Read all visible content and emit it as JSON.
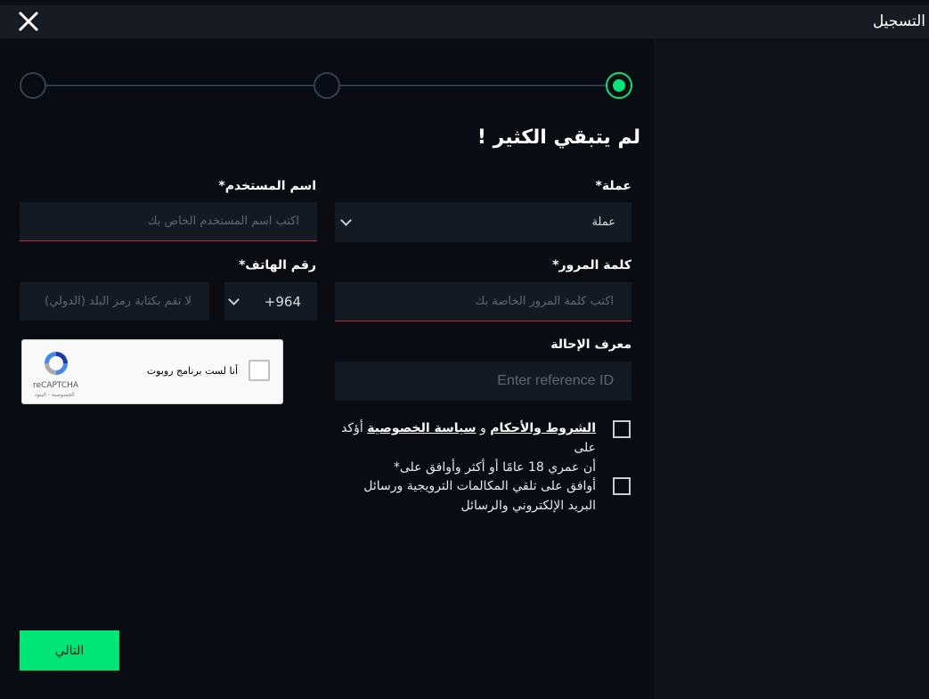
{
  "header": {
    "title": "التسجيل"
  },
  "form": {
    "heading": "لم يتبقي الكثير !",
    "currency": {
      "label": "عملة*",
      "value": "عملة"
    },
    "username": {
      "label": "اسم المستخدم*",
      "placeholder": "اكتب اسم المستخدم الخاص بك"
    },
    "password": {
      "label": "كلمة المرور*",
      "placeholder": "اكتب كلمة المرور الخاصة بك"
    },
    "phone": {
      "label": "رقم الهاتف*",
      "code": "+964",
      "placeholder": "لا تقم بكتابة رمز البلد (الدولي)"
    },
    "referral": {
      "label": "معرف الإحالة",
      "placeholder": "Enter reference ID"
    },
    "captcha": {
      "text": "أنا لست برنامج روبوت",
      "brand": "reCAPTCHA",
      "links": "الخصوصية - البنود"
    },
    "terms": {
      "prefix": "أؤكد على",
      "link_terms": "الشروط والأحكام",
      "and": "و",
      "link_privacy": "سياسة الخصوصية",
      "line2": "أن عمري 18 عامًا أو أكثر وأوافق على*"
    },
    "promo": {
      "line1": "أوافق على تلقي المكالمات الترويجية ورسائل",
      "line2": "البريد الإلكتروني والرسائل"
    },
    "next_label": "التالي"
  },
  "colors": {
    "accent": "#00e676",
    "error": "#c0282d",
    "field_bg": "#141a23"
  },
  "icons": {
    "close": "close-icon",
    "chevron": "chevron-down-icon",
    "recaptcha": "recaptcha-icon"
  }
}
